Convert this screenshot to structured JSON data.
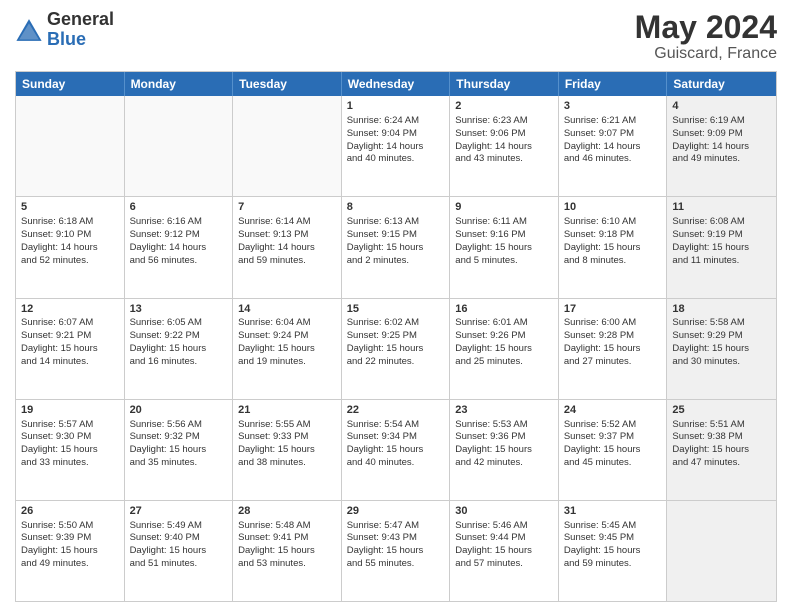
{
  "logo": {
    "general": "General",
    "blue": "Blue"
  },
  "title": "May 2024",
  "subtitle": "Guiscard, France",
  "days": [
    "Sunday",
    "Monday",
    "Tuesday",
    "Wednesday",
    "Thursday",
    "Friday",
    "Saturday"
  ],
  "rows": [
    [
      {
        "day": "",
        "data": "",
        "shaded": false,
        "empty": true
      },
      {
        "day": "",
        "data": "",
        "shaded": false,
        "empty": true
      },
      {
        "day": "",
        "data": "",
        "shaded": false,
        "empty": true
      },
      {
        "day": "1",
        "data": "Sunrise: 6:24 AM\nSunset: 9:04 PM\nDaylight: 14 hours\nand 40 minutes.",
        "shaded": false,
        "empty": false
      },
      {
        "day": "2",
        "data": "Sunrise: 6:23 AM\nSunset: 9:06 PM\nDaylight: 14 hours\nand 43 minutes.",
        "shaded": false,
        "empty": false
      },
      {
        "day": "3",
        "data": "Sunrise: 6:21 AM\nSunset: 9:07 PM\nDaylight: 14 hours\nand 46 minutes.",
        "shaded": false,
        "empty": false
      },
      {
        "day": "4",
        "data": "Sunrise: 6:19 AM\nSunset: 9:09 PM\nDaylight: 14 hours\nand 49 minutes.",
        "shaded": true,
        "empty": false
      }
    ],
    [
      {
        "day": "5",
        "data": "Sunrise: 6:18 AM\nSunset: 9:10 PM\nDaylight: 14 hours\nand 52 minutes.",
        "shaded": false,
        "empty": false
      },
      {
        "day": "6",
        "data": "Sunrise: 6:16 AM\nSunset: 9:12 PM\nDaylight: 14 hours\nand 56 minutes.",
        "shaded": false,
        "empty": false
      },
      {
        "day": "7",
        "data": "Sunrise: 6:14 AM\nSunset: 9:13 PM\nDaylight: 14 hours\nand 59 minutes.",
        "shaded": false,
        "empty": false
      },
      {
        "day": "8",
        "data": "Sunrise: 6:13 AM\nSunset: 9:15 PM\nDaylight: 15 hours\nand 2 minutes.",
        "shaded": false,
        "empty": false
      },
      {
        "day": "9",
        "data": "Sunrise: 6:11 AM\nSunset: 9:16 PM\nDaylight: 15 hours\nand 5 minutes.",
        "shaded": false,
        "empty": false
      },
      {
        "day": "10",
        "data": "Sunrise: 6:10 AM\nSunset: 9:18 PM\nDaylight: 15 hours\nand 8 minutes.",
        "shaded": false,
        "empty": false
      },
      {
        "day": "11",
        "data": "Sunrise: 6:08 AM\nSunset: 9:19 PM\nDaylight: 15 hours\nand 11 minutes.",
        "shaded": true,
        "empty": false
      }
    ],
    [
      {
        "day": "12",
        "data": "Sunrise: 6:07 AM\nSunset: 9:21 PM\nDaylight: 15 hours\nand 14 minutes.",
        "shaded": false,
        "empty": false
      },
      {
        "day": "13",
        "data": "Sunrise: 6:05 AM\nSunset: 9:22 PM\nDaylight: 15 hours\nand 16 minutes.",
        "shaded": false,
        "empty": false
      },
      {
        "day": "14",
        "data": "Sunrise: 6:04 AM\nSunset: 9:24 PM\nDaylight: 15 hours\nand 19 minutes.",
        "shaded": false,
        "empty": false
      },
      {
        "day": "15",
        "data": "Sunrise: 6:02 AM\nSunset: 9:25 PM\nDaylight: 15 hours\nand 22 minutes.",
        "shaded": false,
        "empty": false
      },
      {
        "day": "16",
        "data": "Sunrise: 6:01 AM\nSunset: 9:26 PM\nDaylight: 15 hours\nand 25 minutes.",
        "shaded": false,
        "empty": false
      },
      {
        "day": "17",
        "data": "Sunrise: 6:00 AM\nSunset: 9:28 PM\nDaylight: 15 hours\nand 27 minutes.",
        "shaded": false,
        "empty": false
      },
      {
        "day": "18",
        "data": "Sunrise: 5:58 AM\nSunset: 9:29 PM\nDaylight: 15 hours\nand 30 minutes.",
        "shaded": true,
        "empty": false
      }
    ],
    [
      {
        "day": "19",
        "data": "Sunrise: 5:57 AM\nSunset: 9:30 PM\nDaylight: 15 hours\nand 33 minutes.",
        "shaded": false,
        "empty": false
      },
      {
        "day": "20",
        "data": "Sunrise: 5:56 AM\nSunset: 9:32 PM\nDaylight: 15 hours\nand 35 minutes.",
        "shaded": false,
        "empty": false
      },
      {
        "day": "21",
        "data": "Sunrise: 5:55 AM\nSunset: 9:33 PM\nDaylight: 15 hours\nand 38 minutes.",
        "shaded": false,
        "empty": false
      },
      {
        "day": "22",
        "data": "Sunrise: 5:54 AM\nSunset: 9:34 PM\nDaylight: 15 hours\nand 40 minutes.",
        "shaded": false,
        "empty": false
      },
      {
        "day": "23",
        "data": "Sunrise: 5:53 AM\nSunset: 9:36 PM\nDaylight: 15 hours\nand 42 minutes.",
        "shaded": false,
        "empty": false
      },
      {
        "day": "24",
        "data": "Sunrise: 5:52 AM\nSunset: 9:37 PM\nDaylight: 15 hours\nand 45 minutes.",
        "shaded": false,
        "empty": false
      },
      {
        "day": "25",
        "data": "Sunrise: 5:51 AM\nSunset: 9:38 PM\nDaylight: 15 hours\nand 47 minutes.",
        "shaded": true,
        "empty": false
      }
    ],
    [
      {
        "day": "26",
        "data": "Sunrise: 5:50 AM\nSunset: 9:39 PM\nDaylight: 15 hours\nand 49 minutes.",
        "shaded": false,
        "empty": false
      },
      {
        "day": "27",
        "data": "Sunrise: 5:49 AM\nSunset: 9:40 PM\nDaylight: 15 hours\nand 51 minutes.",
        "shaded": false,
        "empty": false
      },
      {
        "day": "28",
        "data": "Sunrise: 5:48 AM\nSunset: 9:41 PM\nDaylight: 15 hours\nand 53 minutes.",
        "shaded": false,
        "empty": false
      },
      {
        "day": "29",
        "data": "Sunrise: 5:47 AM\nSunset: 9:43 PM\nDaylight: 15 hours\nand 55 minutes.",
        "shaded": false,
        "empty": false
      },
      {
        "day": "30",
        "data": "Sunrise: 5:46 AM\nSunset: 9:44 PM\nDaylight: 15 hours\nand 57 minutes.",
        "shaded": false,
        "empty": false
      },
      {
        "day": "31",
        "data": "Sunrise: 5:45 AM\nSunset: 9:45 PM\nDaylight: 15 hours\nand 59 minutes.",
        "shaded": false,
        "empty": false
      },
      {
        "day": "",
        "data": "",
        "shaded": true,
        "empty": true
      }
    ]
  ]
}
